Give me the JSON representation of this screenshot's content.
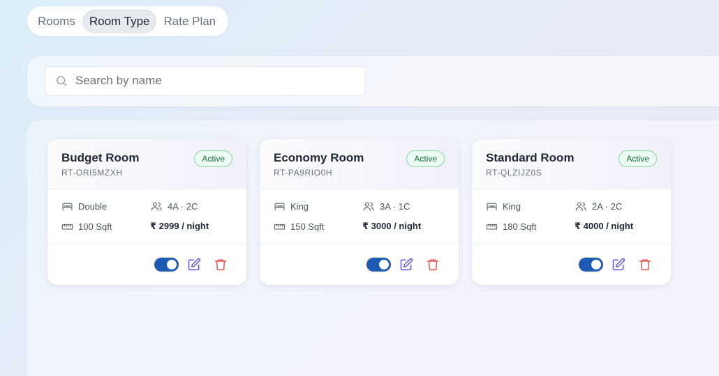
{
  "tabs": [
    {
      "label": "Rooms",
      "active": false
    },
    {
      "label": "Room Type",
      "active": true
    },
    {
      "label": "Rate Plan",
      "active": false
    }
  ],
  "search": {
    "placeholder": "Search by name",
    "value": ""
  },
  "colors": {
    "accent": "#1f5bb5",
    "edit": "#6b5ce7",
    "delete": "#e35d5d",
    "active_badge": "#1f6b3a"
  },
  "cards": [
    {
      "title": "Budget Room",
      "code": "RT-ORI5MZXH",
      "status": "Active",
      "bed": "Double",
      "occupancy": "4A · 2C",
      "size": "100 Sqft",
      "price": "₹ 2999 / night",
      "enabled": true
    },
    {
      "title": "Economy Room",
      "code": "RT-PA9RIO0H",
      "status": "Active",
      "bed": "King",
      "occupancy": "3A · 1C",
      "size": "150 Sqft",
      "price": "₹ 3000 / night",
      "enabled": true
    },
    {
      "title": "Standard Room",
      "code": "RT-QLZIJZ0S",
      "status": "Active",
      "bed": "King",
      "occupancy": "2A · 2C",
      "size": "180 Sqft",
      "price": "₹ 4000 / night",
      "enabled": true
    }
  ]
}
